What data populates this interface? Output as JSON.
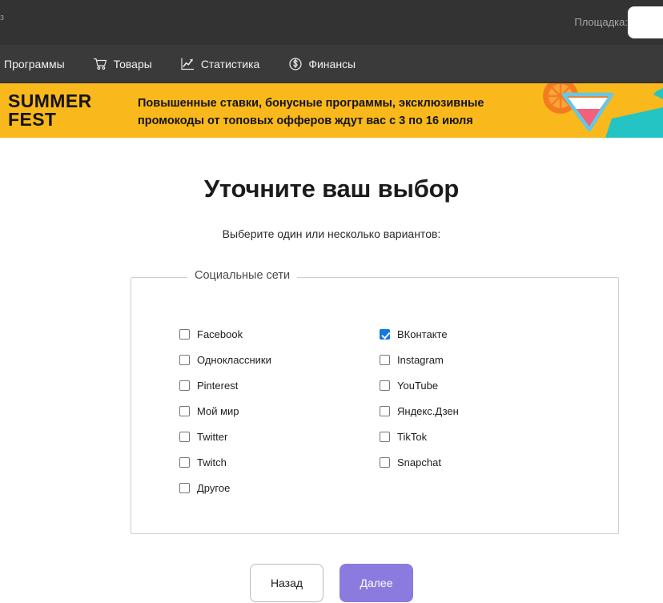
{
  "topbar": {
    "left_stub": "з",
    "site_label": "Площадка:",
    "site_select_value": ""
  },
  "nav": {
    "items": [
      {
        "label": "Программы",
        "icon": "grid-icon"
      },
      {
        "label": "Товары",
        "icon": "cart-icon"
      },
      {
        "label": "Статистика",
        "icon": "line-chart-icon"
      },
      {
        "label": "Финансы",
        "icon": "dollar-circle-icon"
      }
    ]
  },
  "banner": {
    "logo_line1": "SUMMER",
    "logo_line2": "FEST",
    "text_line1": "Повышенные ставки, бонусные программы, эксклюзивные",
    "text_line2": "промокоды от топовых офферов ждут вас с 3 по 16 июля",
    "bg_color": "#f9b81c",
    "text_color": "#141414"
  },
  "main": {
    "title": "Уточните ваш выбор",
    "subtitle": "Выберите один или несколько вариантов:",
    "group": {
      "legend": "Социальные сети",
      "left_column": [
        {
          "label": "Facebook",
          "checked": false
        },
        {
          "label": "Одноклассники",
          "checked": false
        },
        {
          "label": "Pinterest",
          "checked": false
        },
        {
          "label": "Мой мир",
          "checked": false
        },
        {
          "label": "Twitter",
          "checked": false
        },
        {
          "label": "Twitch",
          "checked": false
        },
        {
          "label": "Другое",
          "checked": false
        }
      ],
      "right_column": [
        {
          "label": "ВКонтакте",
          "checked": true
        },
        {
          "label": "Instagram",
          "checked": false
        },
        {
          "label": "YouTube",
          "checked": false
        },
        {
          "label": "Яндекс.Дзен",
          "checked": false
        },
        {
          "label": "TikTok",
          "checked": false
        },
        {
          "label": "Snapchat",
          "checked": false
        }
      ]
    }
  },
  "footer": {
    "back_label": "Назад",
    "next_label": "Далее",
    "next_color": "#8b7bdf"
  }
}
